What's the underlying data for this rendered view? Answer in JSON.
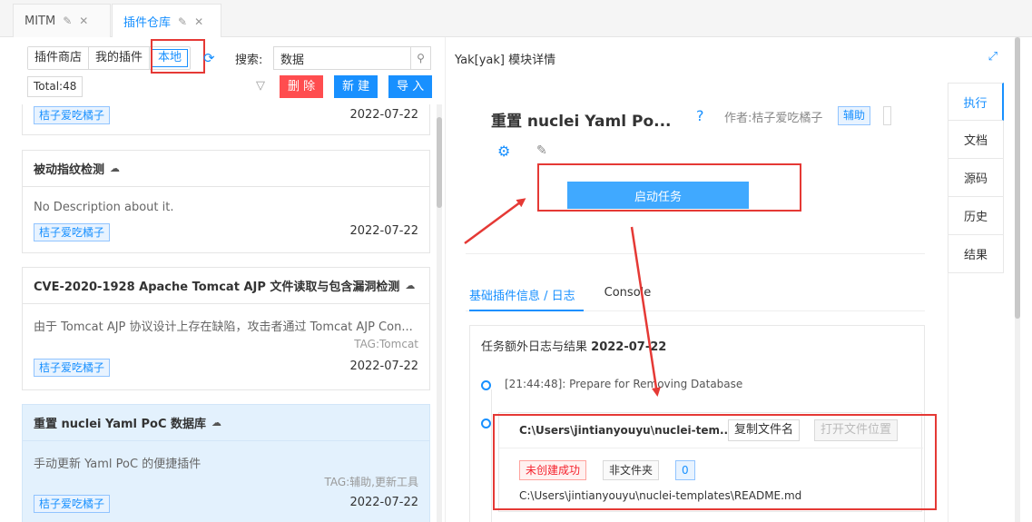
{
  "top_tabs": [
    {
      "label": "MITM",
      "edit_icon": "✎",
      "close_icon": "✕"
    },
    {
      "label": "插件仓库",
      "edit_icon": "✎",
      "close_icon": "✕"
    }
  ],
  "left": {
    "segments": [
      "插件商店",
      "我的插件",
      "本地"
    ],
    "search_label": "搜索:",
    "search_value": "数据",
    "total": "Total:48",
    "buttons": {
      "delete": "删 除",
      "new": "新 建",
      "import": "导 入"
    },
    "cards": [
      {
        "title": "",
        "desc": "",
        "tag": "",
        "author": "桔子爱吃橘子",
        "date": "2022-07-22"
      },
      {
        "title": "被动指纹检测",
        "desc": "No Description about it.",
        "tag": "",
        "author": "桔子爱吃橘子",
        "date": "2022-07-22"
      },
      {
        "title": "CVE-2020-1928 Apache Tomcat AJP 文件读取与包含漏洞检测",
        "desc": "由于 Tomcat AJP 协议设计上存在缺陷，攻击者通过 Tomcat AJP Con...",
        "tag": "TAG:Tomcat",
        "author": "桔子爱吃橘子",
        "date": "2022-07-22"
      },
      {
        "title": "重置 nuclei Yaml PoC 数据库",
        "desc": "手动更新 Yaml PoC 的便捷插件",
        "tag": "TAG:辅助,更新工具",
        "author": "桔子爱吃橘子",
        "date": "2022-07-22"
      }
    ]
  },
  "right": {
    "panel_title": "Yak[yak] 模块详情",
    "detail_title": "重置 nuclei Yaml Po...",
    "author": "作者:桔子爱吃橘子",
    "aux_tag": "辅助",
    "start_button": "启动任务",
    "sub_tabs": [
      "基础插件信息 / 日志",
      "Console"
    ],
    "log_title": "任务额外日志与结果",
    "log_date": "2022-07-22",
    "log_line": "[21:44:48]: Prepare for Removing Database",
    "file": {
      "name": "C:\\Users\\jintianyouyu\\nuclei-tem...",
      "copy": "复制文件名",
      "open": "打开文件位置",
      "tag_fail": "未创建成功",
      "tag_notdir": "非文件夹",
      "tag_count": "0",
      "path": "C:\\Users\\jintianyouyu\\nuclei-templates\\README.md"
    },
    "side_tabs": [
      "执行",
      "文档",
      "源码",
      "历史",
      "结果"
    ]
  },
  "colors": {
    "accent": "#1890ff",
    "danger": "#ff4d4f",
    "highlight": "#e53935",
    "selected_card": "#e3f1fd"
  }
}
